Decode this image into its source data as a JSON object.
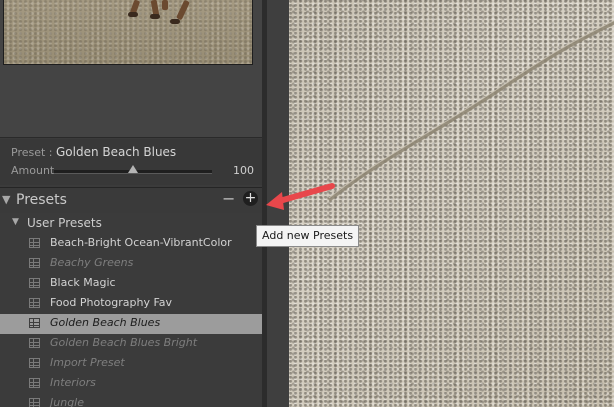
{
  "preset_panel": {
    "preset_label": "Preset :",
    "preset_value": "Golden Beach Blues",
    "amount_label": "Amount",
    "amount_value": "100",
    "amount_fraction": 0.5
  },
  "presets_header": {
    "title": "Presets",
    "minus_label": "−",
    "plus_label": "+",
    "tooltip": "Add new Presets"
  },
  "user_presets": {
    "label": "User Presets",
    "items": [
      {
        "label": "Beach-Bright Ocean-VibrantColor",
        "state": "normal"
      },
      {
        "label": "Beachy Greens",
        "state": "dim"
      },
      {
        "label": "Black Magic",
        "state": "normal"
      },
      {
        "label": "Food Photography Fav",
        "state": "normal"
      },
      {
        "label": "Golden Beach Blues",
        "state": "selected"
      },
      {
        "label": "Golden Beach Blues Bright",
        "state": "dim"
      },
      {
        "label": "Import Preset",
        "state": "dim"
      },
      {
        "label": "Interiors",
        "state": "dim"
      },
      {
        "label": "Jungle",
        "state": "dim"
      }
    ]
  },
  "colors": {
    "panel_bg": "#3b3b3b",
    "selected_row": "#9c9c9c",
    "arrow": "#e8474b"
  }
}
